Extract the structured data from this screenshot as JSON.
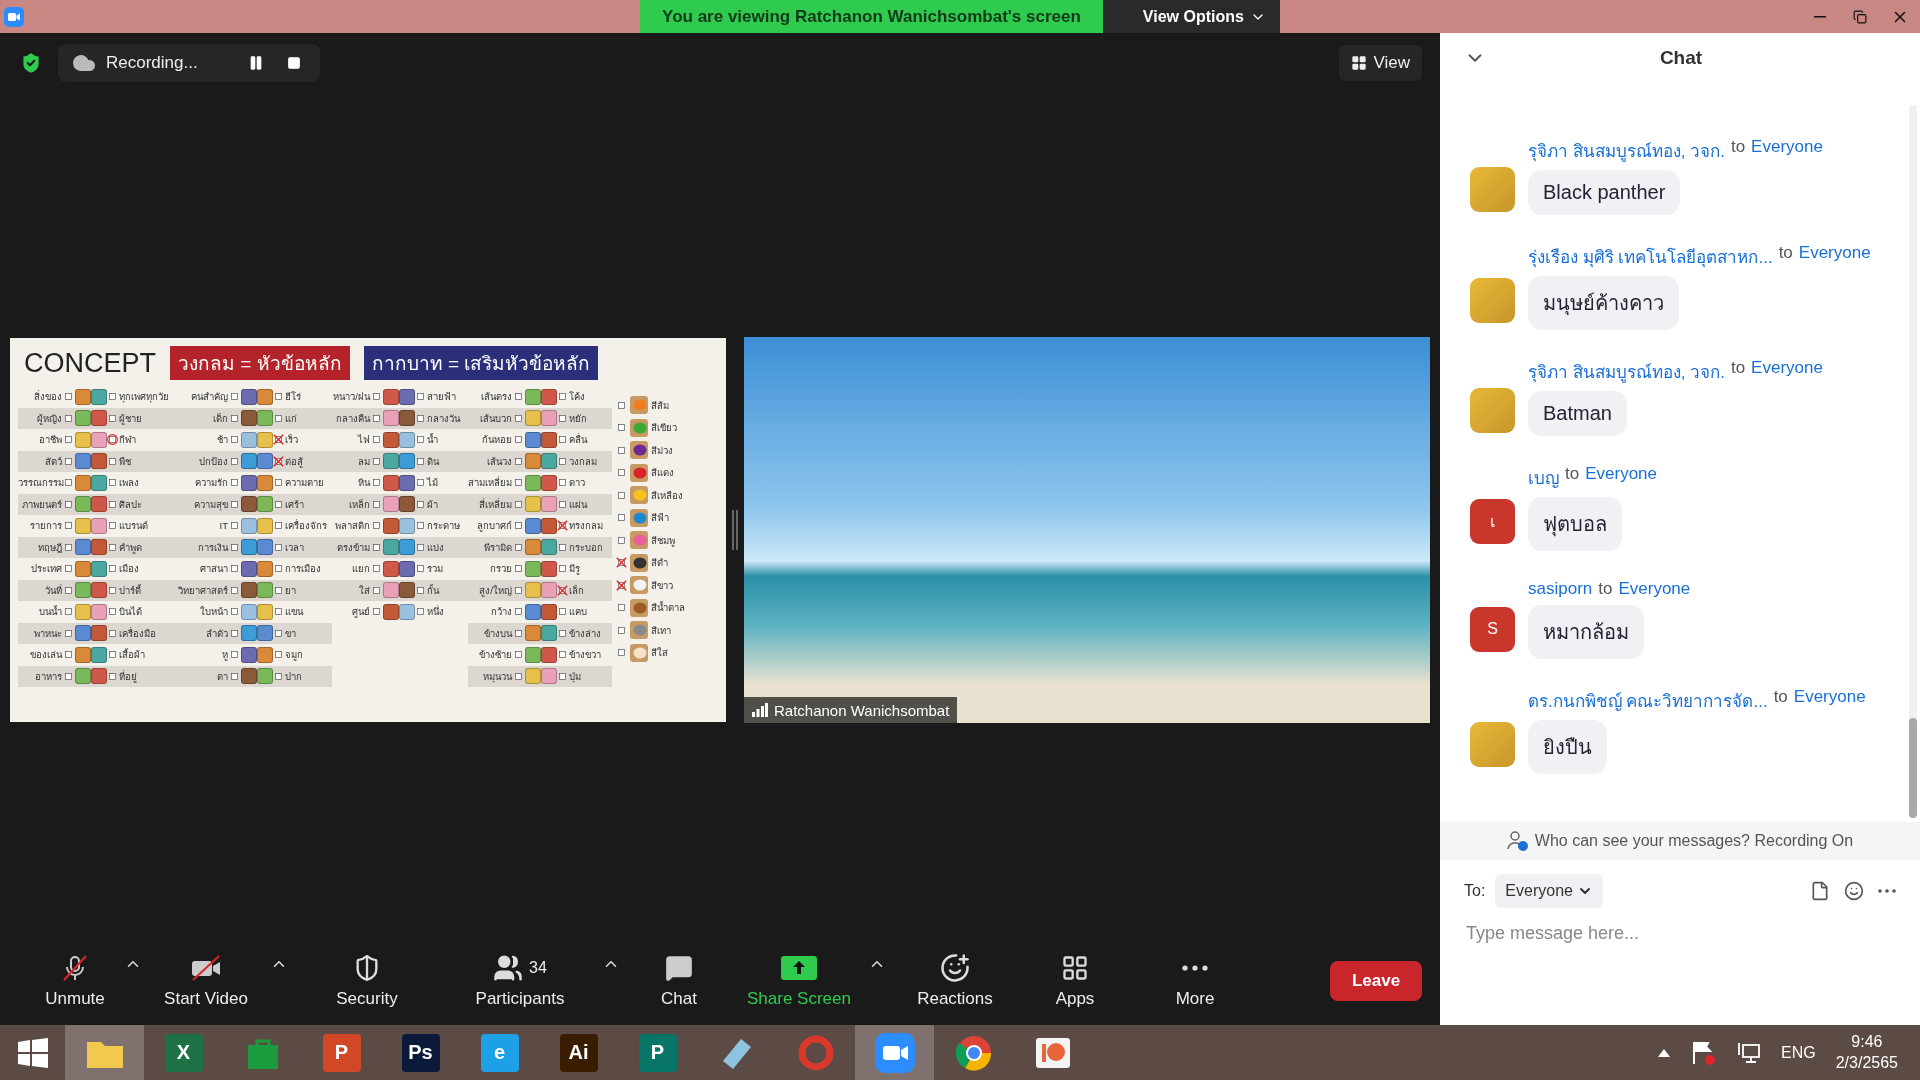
{
  "title_bar": {
    "banner": "You are viewing Ratchanon Wanichsombat's screen",
    "view_options": "View Options"
  },
  "meeting": {
    "recording": "Recording...",
    "view_button": "View",
    "shared_screen": {
      "slide": {
        "title": "CONCEPT",
        "legend": [
          {
            "text": "วงกลม = หัวข้อหลัก",
            "color": "#b5232a"
          },
          {
            "text": "กากบาท = เสริมหัวข้อหลัก",
            "color": "#2b2f7a"
          }
        ],
        "groups": [
          {
            "rows": [
              {
                "left": {
                  "label": "สิ่งของ",
                  "circled": false,
                  "crossed": false
                },
                "right": {
                  "label": "ทุกเพศทุกวัย",
                  "circled": false,
                  "crossed": false
                }
              },
              {
                "left": {
                  "label": "ผู้หญิง",
                  "circled": false,
                  "crossed": false
                },
                "right": {
                  "label": "ผู้ชาย",
                  "circled": false,
                  "crossed": false
                }
              },
              {
                "left": {
                  "label": "อาชีพ",
                  "circled": false,
                  "crossed": false
                },
                "right": {
                  "label": "กีฬา",
                  "circled": true,
                  "crossed": false
                }
              },
              {
                "left": {
                  "label": "สัตว์",
                  "circled": false,
                  "crossed": false
                },
                "right": {
                  "label": "พืช",
                  "circled": false,
                  "crossed": false
                }
              },
              {
                "left": {
                  "label": "วรรณกรรม",
                  "circled": false,
                  "crossed": false
                },
                "right": {
                  "label": "เพลง",
                  "circled": false,
                  "crossed": false
                }
              },
              {
                "left": {
                  "label": "ภาพยนตร์",
                  "circled": false,
                  "crossed": false
                },
                "right": {
                  "label": "ศิลปะ",
                  "circled": false,
                  "crossed": false
                }
              },
              {
                "left": {
                  "label": "รายการ",
                  "circled": false,
                  "crossed": false
                },
                "right": {
                  "label": "แบรนด์",
                  "circled": false,
                  "crossed": false
                }
              },
              {
                "left": {
                  "label": "ทฤษฎี",
                  "circled": false,
                  "crossed": false
                },
                "right": {
                  "label": "คำพูด",
                  "circled": false,
                  "crossed": false
                }
              },
              {
                "left": {
                  "label": "ประเทศ",
                  "circled": false,
                  "crossed": false
                },
                "right": {
                  "label": "เมือง",
                  "circled": false,
                  "crossed": false
                }
              },
              {
                "left": {
                  "label": "วันที่",
                  "circled": false,
                  "crossed": false
                },
                "right": {
                  "label": "ปาร์ตี้",
                  "circled": false,
                  "crossed": false
                }
              },
              {
                "left": {
                  "label": "บนน้ำ",
                  "circled": false,
                  "crossed": false
                },
                "right": {
                  "label": "บินได้",
                  "circled": false,
                  "crossed": false
                }
              },
              {
                "left": {
                  "label": "พาหนะ",
                  "circled": false,
                  "crossed": false
                },
                "right": {
                  "label": "เครื่องมือ",
                  "circled": false,
                  "crossed": false
                }
              },
              {
                "left": {
                  "label": "ของเล่น",
                  "circled": false,
                  "crossed": false
                },
                "right": {
                  "label": "เสื้อผ้า",
                  "circled": false,
                  "crossed": false
                }
              },
              {
                "left": {
                  "label": "อาหาร",
                  "circled": false,
                  "crossed": false
                },
                "right": {
                  "label": "ที่อยู่",
                  "circled": false,
                  "crossed": false
                }
              }
            ]
          },
          {
            "rows": [
              {
                "left": {
                  "label": "คนสำคัญ",
                  "circled": false,
                  "crossed": false
                },
                "right": {
                  "label": "ฮีโร่",
                  "circled": false,
                  "crossed": false
                }
              },
              {
                "left": {
                  "label": "เด็ก",
                  "circled": false,
                  "crossed": false
                },
                "right": {
                  "label": "แก่",
                  "circled": false,
                  "crossed": false
                }
              },
              {
                "left": {
                  "label": "ช้า",
                  "circled": false,
                  "crossed": false
                },
                "right": {
                  "label": "เร็ว",
                  "circled": false,
                  "crossed": true
                }
              },
              {
                "left": {
                  "label": "ปกป้อง",
                  "circled": false,
                  "crossed": false
                },
                "right": {
                  "label": "ต่อสู้",
                  "circled": false,
                  "crossed": true
                }
              },
              {
                "left": {
                  "label": "ความรัก",
                  "circled": false,
                  "crossed": false
                },
                "right": {
                  "label": "ความตาย",
                  "circled": false,
                  "crossed": false
                }
              },
              {
                "left": {
                  "label": "ความสุข",
                  "circled": false,
                  "crossed": false
                },
                "right": {
                  "label": "เศร้า",
                  "circled": false,
                  "crossed": false
                }
              },
              {
                "left": {
                  "label": "IT",
                  "circled": false,
                  "crossed": false
                },
                "right": {
                  "label": "เครื่องจักร",
                  "circled": false,
                  "crossed": false
                }
              },
              {
                "left": {
                  "label": "การเงิน",
                  "circled": false,
                  "crossed": false
                },
                "right": {
                  "label": "เวลา",
                  "circled": false,
                  "crossed": false
                }
              },
              {
                "left": {
                  "label": "ศาสนา",
                  "circled": false,
                  "crossed": false
                },
                "right": {
                  "label": "การเมือง",
                  "circled": false,
                  "crossed": false
                }
              },
              {
                "left": {
                  "label": "วิทยาศาสตร์",
                  "circled": false,
                  "crossed": false
                },
                "right": {
                  "label": "ยา",
                  "circled": false,
                  "crossed": false
                }
              },
              {
                "left": {
                  "label": "ใบหน้า",
                  "circled": false,
                  "crossed": false
                },
                "right": {
                  "label": "แขน",
                  "circled": false,
                  "crossed": false
                }
              },
              {
                "left": {
                  "label": "ลำตัว",
                  "circled": false,
                  "crossed": false
                },
                "right": {
                  "label": "ขา",
                  "circled": false,
                  "crossed": false
                }
              },
              {
                "left": {
                  "label": "หู",
                  "circled": false,
                  "crossed": false
                },
                "right": {
                  "label": "จมูก",
                  "circled": false,
                  "crossed": false
                }
              },
              {
                "left": {
                  "label": "ตา",
                  "circled": false,
                  "crossed": false
                },
                "right": {
                  "label": "ปาก",
                  "circled": false,
                  "crossed": false
                }
              }
            ]
          },
          {
            "rows": [
              {
                "left": {
                  "label": "หนาว/ฝน",
                  "circled": false,
                  "crossed": false
                },
                "right": {
                  "label": "สายฟ้า",
                  "circled": false,
                  "crossed": false
                }
              },
              {
                "left": {
                  "label": "กลางคืน",
                  "circled": false,
                  "crossed": false
                },
                "right": {
                  "label": "กลางวัน",
                  "circled": false,
                  "crossed": false
                }
              },
              {
                "left": {
                  "label": "ไฟ",
                  "circled": false,
                  "crossed": false
                },
                "right": {
                  "label": "น้ำ",
                  "circled": false,
                  "crossed": false
                }
              },
              {
                "left": {
                  "label": "ลม",
                  "circled": false,
                  "crossed": false
                },
                "right": {
                  "label": "ดิน",
                  "circled": false,
                  "crossed": false
                }
              },
              {
                "left": {
                  "label": "หิน",
                  "circled": false,
                  "crossed": false
                },
                "right": {
                  "label": "ไม้",
                  "circled": false,
                  "crossed": false
                }
              },
              {
                "left": {
                  "label": "เหล็ก",
                  "circled": false,
                  "crossed": false
                },
                "right": {
                  "label": "ผ้า",
                  "circled": false,
                  "crossed": false
                }
              },
              {
                "left": {
                  "label": "พลาสติก",
                  "circled": false,
                  "crossed": false
                },
                "right": {
                  "label": "กระดาษ",
                  "circled": false,
                  "crossed": false
                }
              },
              {
                "left": {
                  "label": "ตรงข้าม",
                  "circled": false,
                  "crossed": false
                },
                "right": {
                  "label": "แบ่ง",
                  "circled": false,
                  "crossed": false
                }
              },
              {
                "left": {
                  "label": "แยก",
                  "circled": false,
                  "crossed": false
                },
                "right": {
                  "label": "รวม",
                  "circled": false,
                  "crossed": false
                }
              },
              {
                "left": {
                  "label": "ใส่",
                  "circled": false,
                  "crossed": false
                },
                "right": {
                  "label": "กั้น",
                  "circled": false,
                  "crossed": false
                }
              },
              {
                "left": {
                  "label": "ศูนย์",
                  "circled": false,
                  "crossed": false
                },
                "right": {
                  "label": "หนึ่ง",
                  "circled": false,
                  "crossed": false
                }
              }
            ]
          },
          {
            "rows": [
              {
                "left": {
                  "label": "เส้นตรง",
                  "circled": false,
                  "crossed": false
                },
                "right": {
                  "label": "โค้ง",
                  "circled": false,
                  "crossed": false
                }
              },
              {
                "left": {
                  "label": "เส้นบวก",
                  "circled": false,
                  "crossed": false
                },
                "right": {
                  "label": "หยัก",
                  "circled": false,
                  "crossed": false
                }
              },
              {
                "left": {
                  "label": "ก้นหอย",
                  "circled": false,
                  "crossed": false
                },
                "right": {
                  "label": "คลื่น",
                  "circled": false,
                  "crossed": false
                }
              },
              {
                "left": {
                  "label": "เส้นวง",
                  "circled": false,
                  "crossed": false
                },
                "right": {
                  "label": "วงกลม",
                  "circled": false,
                  "crossed": false
                }
              },
              {
                "left": {
                  "label": "สามเหลี่ยม",
                  "circled": false,
                  "crossed": false
                },
                "right": {
                  "label": "ดาว",
                  "circled": false,
                  "crossed": false
                }
              },
              {
                "left": {
                  "label": "สี่เหลี่ยม",
                  "circled": false,
                  "crossed": false
                },
                "right": {
                  "label": "แผ่น",
                  "circled": false,
                  "crossed": false
                }
              },
              {
                "left": {
                  "label": "ลูกบาศก์",
                  "circled": false,
                  "crossed": false
                },
                "right": {
                  "label": "ทรงกลม",
                  "circled": false,
                  "crossed": true
                }
              },
              {
                "left": {
                  "label": "พีรามิด",
                  "circled": false,
                  "crossed": false
                },
                "right": {
                  "label": "กระบอก",
                  "circled": false,
                  "crossed": false
                }
              },
              {
                "left": {
                  "label": "กรวย",
                  "circled": false,
                  "crossed": false
                },
                "right": {
                  "label": "มีรู",
                  "circled": false,
                  "crossed": false
                }
              },
              {
                "left": {
                  "label": "สูง/ใหญ่",
                  "circled": false,
                  "crossed": false
                },
                "right": {
                  "label": "เล็ก",
                  "circled": false,
                  "crossed": true
                }
              },
              {
                "left": {
                  "label": "กว้าง",
                  "circled": false,
                  "crossed": false
                },
                "right": {
                  "label": "แคบ",
                  "circled": false,
                  "crossed": false
                }
              },
              {
                "left": {
                  "label": "ข้างบน",
                  "circled": false,
                  "crossed": false
                },
                "right": {
                  "label": "ข้างล่าง",
                  "circled": false,
                  "crossed": false
                }
              },
              {
                "left": {
                  "label": "ข้างซ้าย",
                  "circled": false,
                  "crossed": false
                },
                "right": {
                  "label": "ข้างขวา",
                  "circled": false,
                  "crossed": false
                }
              },
              {
                "left": {
                  "label": "หมุนวน",
                  "circled": false,
                  "crossed": false
                },
                "right": {
                  "label": "ปุ่ม",
                  "circled": false,
                  "crossed": false
                }
              }
            ]
          }
        ],
        "colors": [
          {
            "label": "สีส้ม",
            "color": "#ef7d22",
            "crossed": false
          },
          {
            "label": "สีเขียว",
            "color": "#3aa935",
            "crossed": false
          },
          {
            "label": "สีม่วง",
            "color": "#6a2a8f",
            "crossed": false
          },
          {
            "label": "สีแดง",
            "color": "#d9232a",
            "crossed": false
          },
          {
            "label": "สีเหลือง",
            "color": "#f6c21c",
            "crossed": false
          },
          {
            "label": "สีฟ้า",
            "color": "#1e88d0",
            "crossed": false
          },
          {
            "label": "สีชมพู",
            "color": "#ef5fa0",
            "crossed": false
          },
          {
            "label": "สีดำ",
            "color": "#333333",
            "crossed": true
          },
          {
            "label": "สีขาว",
            "color": "#f2f2f2",
            "crossed": true
          },
          {
            "label": "สีน้ำตาล",
            "color": "#9a5a2a",
            "crossed": false
          },
          {
            "label": "สีเทา",
            "color": "#8a8a8a",
            "crossed": false
          },
          {
            "label": "สีใส",
            "color": "#f3e3c8",
            "crossed": false
          }
        ]
      }
    },
    "video": {
      "participant_name": "Ratchanon Wanichsombat"
    },
    "toolbar": [
      {
        "kind": "mic",
        "label": "Unmute",
        "caret": true,
        "highlighted": false
      },
      {
        "kind": "video",
        "label": "Start Video",
        "caret": true,
        "highlighted": false
      },
      {
        "kind": "security",
        "label": "Security",
        "caret": false,
        "highlighted": false
      },
      {
        "kind": "participants",
        "label": "Participants",
        "count": "34",
        "caret": true,
        "highlighted": false
      },
      {
        "kind": "chat",
        "label": "Chat",
        "caret": false,
        "highlighted": false
      },
      {
        "kind": "share",
        "label": "Share Screen",
        "caret": true,
        "highlighted": true
      },
      {
        "kind": "reactions",
        "label": "Reactions",
        "caret": false,
        "highlighted": false
      },
      {
        "kind": "apps",
        "label": "Apps",
        "caret": false,
        "highlighted": false
      },
      {
        "kind": "more",
        "label": "More",
        "caret": false,
        "highlighted": false
      }
    ],
    "leave": "Leave"
  },
  "chat": {
    "title": "Chat",
    "messages": [
      {
        "sender": "รุจิภา สินสมบูรณ์ทอง, วจก.",
        "to": "to",
        "recipient": "Everyone",
        "text": "Black panther",
        "avatar": {
          "kind": "photo"
        }
      },
      {
        "sender": "รุ่งเรือง มุศิริ เทคโนโลยีอุตสาหก...",
        "to": "to",
        "recipient": "Everyone",
        "text": "มนุษย์ค้างคาว",
        "avatar": {
          "kind": "photo"
        }
      },
      {
        "sender": "รุจิภา สินสมบูรณ์ทอง, วจก.",
        "to": "to",
        "recipient": "Everyone",
        "text": "Batman",
        "avatar": {
          "kind": "photo"
        }
      },
      {
        "sender": "เบญ",
        "to": "to",
        "recipient": "Everyone",
        "text": "ฟุตบอล",
        "avatar": {
          "kind": "initial",
          "initial": "เ",
          "color": "#c9372c"
        }
      },
      {
        "sender": "sasiporn",
        "to": "to",
        "recipient": "Everyone",
        "text": "หมากล้อม",
        "avatar": {
          "kind": "initial",
          "initial": "S",
          "color": "#c9372c"
        }
      },
      {
        "sender": "ดร.กนกพิชญ์ คณะวิทยาการจัด...",
        "to": "to",
        "recipient": "Everyone",
        "text": "ยิงปืน",
        "avatar": {
          "kind": "photo"
        }
      }
    ],
    "notice": "Who can see your messages? Recording On",
    "to_label": "To:",
    "recipient": "Everyone",
    "placeholder": "Type message here..."
  },
  "taskbar": {
    "apps": [
      {
        "kind": "folder",
        "color": "#f2c94c",
        "selected": true
      },
      {
        "kind": "letter",
        "glyph": "X",
        "color": "#1e7145",
        "selected": false
      },
      {
        "kind": "bag",
        "color": "#1a9c3e",
        "selected": false
      },
      {
        "kind": "letter",
        "glyph": "P",
        "color": "#d24726",
        "selected": false
      },
      {
        "kind": "letter",
        "glyph": "Ps",
        "color": "#0b1a3a",
        "selected": false
      },
      {
        "kind": "letter",
        "glyph": "e",
        "color": "#1ea0e6",
        "selected": false
      },
      {
        "kind": "letter",
        "glyph": "Ai",
        "color": "#3a1d00",
        "selected": false
      },
      {
        "kind": "letter",
        "glyph": "P",
        "color": "#077568",
        "selected": false
      },
      {
        "kind": "eraser",
        "color": "#8fc4e0",
        "selected": false
      },
      {
        "kind": "ring",
        "color": "#d9392b",
        "selected": false
      },
      {
        "kind": "camera",
        "color": "#2d8cff",
        "selected": true
      },
      {
        "kind": "chrome",
        "color": "#db4437",
        "selected": false
      },
      {
        "kind": "image",
        "color": "#e8643a",
        "selected": false
      }
    ],
    "language": "ENG",
    "time": "9:46",
    "date": "2/3/2565"
  }
}
